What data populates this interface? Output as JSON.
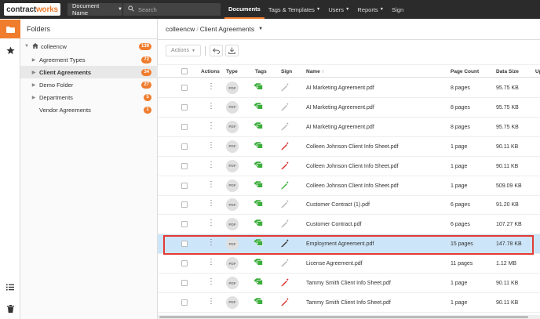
{
  "topbar": {
    "logo_a": "contract",
    "logo_b": "works",
    "doc_name_label": "Document Name",
    "search_placeholder": "Search",
    "nav": [
      {
        "label": "Documents",
        "active": true,
        "has_menu": false
      },
      {
        "label": "Tags & Templates",
        "active": false,
        "has_menu": true
      },
      {
        "label": "Users",
        "active": false,
        "has_menu": true
      },
      {
        "label": "Reports",
        "active": false,
        "has_menu": true
      },
      {
        "label": "Sign",
        "active": false,
        "has_menu": false
      }
    ]
  },
  "rail": {
    "icons": [
      "folder-icon",
      "star-icon",
      "list-icon",
      "trash-icon"
    ]
  },
  "folders": {
    "title": "Folders",
    "tree": [
      {
        "label": "colleencw",
        "count": "139",
        "depth": 0,
        "expanded": true,
        "home": true,
        "selected": false
      },
      {
        "label": "Agreement Types",
        "count": "72",
        "depth": 1,
        "expanded": false,
        "home": false,
        "selected": false
      },
      {
        "label": "Client Agreements",
        "count": "34",
        "depth": 1,
        "expanded": false,
        "home": false,
        "selected": true
      },
      {
        "label": "Demo Folder",
        "count": "27",
        "depth": 1,
        "expanded": false,
        "home": false,
        "selected": false
      },
      {
        "label": "Departments",
        "count": "5",
        "depth": 1,
        "expanded": false,
        "home": false,
        "selected": false
      },
      {
        "label": "Vendor Agreements",
        "count": "1",
        "depth": 1,
        "leaf": true,
        "home": false,
        "selected": false
      }
    ]
  },
  "main": {
    "breadcrumb_root": "colleencw",
    "breadcrumb_sep": "/",
    "breadcrumb_current": "Client Agreements",
    "actions_label": "Actions",
    "columns": {
      "actions": "Actions",
      "type": "Type",
      "tags": "Tags",
      "sign": "Sign",
      "name": "Name",
      "page_count": "Page Count",
      "data_size": "Data Size",
      "more": "Up"
    },
    "type_label": "PDF",
    "rows": [
      {
        "name": "AI Marketing Agreement.pdf",
        "pages": "8 pages",
        "size": "95.75 KB",
        "sign": "gray",
        "highlight": false
      },
      {
        "name": "AI Marketing Agreement.pdf",
        "pages": "8 pages",
        "size": "95.75 KB",
        "sign": "gray",
        "highlight": false
      },
      {
        "name": "AI Marketing Agreement.pdf",
        "pages": "8 pages",
        "size": "95.75 KB",
        "sign": "gray",
        "highlight": false
      },
      {
        "name": "Colleen Johnson Client Info Sheet.pdf",
        "pages": "1 page",
        "size": "90.11 KB",
        "sign": "red",
        "highlight": false
      },
      {
        "name": "Colleen Johnson Client Info Sheet.pdf",
        "pages": "1 page",
        "size": "90.11 KB",
        "sign": "red",
        "highlight": false
      },
      {
        "name": "Colleen Johnson Client Info Sheet.pdf",
        "pages": "1 page",
        "size": "509.09 KB",
        "sign": "green",
        "highlight": false
      },
      {
        "name": "Customer Contract (1).pdf",
        "pages": "6 pages",
        "size": "91.20 KB",
        "sign": "gray",
        "highlight": false
      },
      {
        "name": "Customer Contract.pdf",
        "pages": "6 pages",
        "size": "107.27 KB",
        "sign": "gray",
        "highlight": false
      },
      {
        "name": "Employment Agreement.pdf",
        "pages": "15 pages",
        "size": "147.78 KB",
        "sign": "dark",
        "highlight": true
      },
      {
        "name": "License Agreement.pdf",
        "pages": "11 pages",
        "size": "1.12 MB",
        "sign": "gray",
        "highlight": false
      },
      {
        "name": "Tammy Smith Client Info Sheet.pdf",
        "pages": "1 page",
        "size": "90.11 KB",
        "sign": "red",
        "highlight": false
      },
      {
        "name": "Tammy Smith Client Info Sheet.pdf",
        "pages": "1 page",
        "size": "90.11 KB",
        "sign": "red",
        "highlight": false
      }
    ]
  },
  "colors": {
    "accent": "#f07c2e",
    "topbar": "#2b2b2b",
    "row_highlight": "#cde5f8",
    "annotation_box": "#e53935",
    "tag_green": "#3cae3c",
    "sign_red": "#d9302c",
    "sign_green": "#3cae3c",
    "sign_gray": "#b5b5b5",
    "sign_dark": "#333333"
  }
}
